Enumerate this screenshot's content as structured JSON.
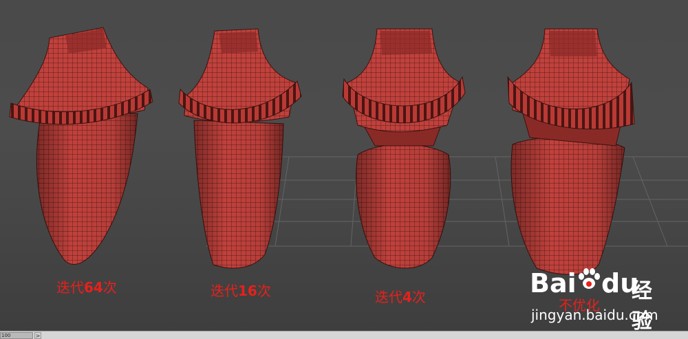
{
  "viewport": {
    "labels": [
      {
        "prefix": "迭代",
        "number": "64",
        "suffix": "次"
      },
      {
        "prefix": "迭代",
        "number": "16",
        "suffix": "次"
      },
      {
        "prefix": "迭代",
        "number": "4",
        "suffix": "次"
      },
      {
        "prefix": "",
        "number": "",
        "suffix": "不优化"
      }
    ],
    "colors": {
      "mesh": "#c0413c",
      "wire": "#3a1210",
      "label": "#e8201c",
      "grid": "#6a6a6a"
    }
  },
  "watermark": {
    "brand_latin_1": "Bai",
    "brand_latin_2": "du",
    "brand_cn": "经验",
    "url": "jingyan.baidu.com"
  },
  "timebar": {
    "frame_label": "100",
    "next_glyph": ">"
  }
}
